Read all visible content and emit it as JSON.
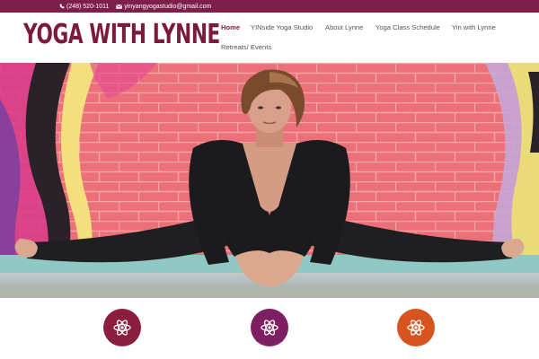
{
  "topbar": {
    "phone": "(248) 520-1011",
    "email": "yinyangyogastudio@gmail.com",
    "background": "#7d1f4a",
    "phone_icon": "phone-icon",
    "email_icon": "envelope-icon"
  },
  "header": {
    "logo": "YOGA WITH LYNNE",
    "logo_color": "#7d1a3c"
  },
  "nav": {
    "items": [
      {
        "label": "Home",
        "active": true
      },
      {
        "label": "YINside Yoga Studio",
        "active": false
      },
      {
        "label": "About Lynne",
        "active": false
      },
      {
        "label": "Yoga Class Schedule",
        "active": false
      },
      {
        "label": "Yin with Lynne",
        "active": false
      },
      {
        "label": "Retreats/ Events",
        "active": false
      }
    ],
    "active_color": "#7d1a3c"
  },
  "features": {
    "icon": "atom-icon",
    "items": [
      {
        "color": "#8b1d3f"
      },
      {
        "color": "#7d1f62"
      },
      {
        "color": "#d6541f"
      }
    ]
  }
}
